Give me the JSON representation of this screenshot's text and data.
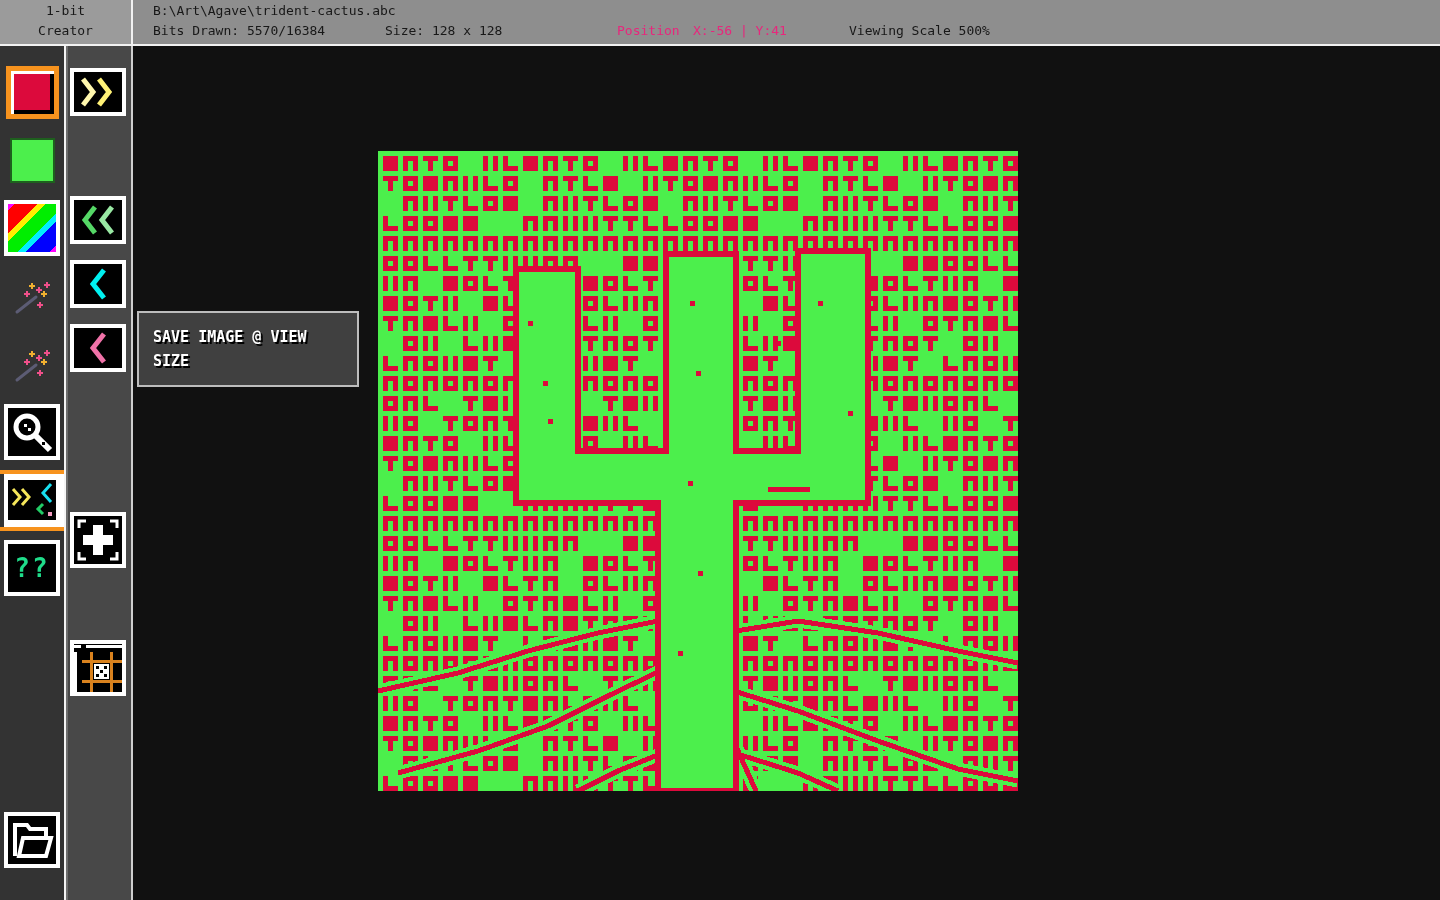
{
  "app_title": [
    "1-bit",
    "Creator"
  ],
  "file_path": "B:\\Art\\Agave\\trident-cactus.abc",
  "status": {
    "bits_drawn": "Bits Drawn: 5570/16384",
    "size": "Size: 128 x 128",
    "position_label": "Position",
    "position_value": "X:-56 | Y:41",
    "viewing_scale": "Viewing Scale 500%"
  },
  "palette": [
    {
      "kind": "solid",
      "color": "#dc0a3c",
      "selected": true
    },
    {
      "kind": "solid",
      "color": "#4cef4c",
      "selected": false
    },
    {
      "kind": "rainbow",
      "selected": false
    }
  ],
  "tools": [
    {
      "kind": "wand",
      "selected": false
    },
    {
      "kind": "wand",
      "selected": false
    },
    {
      "kind": "zoom",
      "selected": false
    },
    {
      "kind": "pattern",
      "selected": true
    },
    {
      "kind": "help",
      "label": "??",
      "selected": false
    },
    {
      "kind": "open",
      "selected": false
    }
  ],
  "secondary_tools": [
    {
      "kind": "double-right",
      "color": "#fff176"
    },
    {
      "kind": "double-left",
      "color": "#55d866"
    },
    {
      "kind": "left",
      "color": "#00f0f0"
    },
    {
      "kind": "left",
      "color": "#f072a8"
    },
    {
      "kind": "plus"
    },
    {
      "kind": "grid"
    }
  ],
  "tooltip": {
    "text": "SAVE IMAGE @ VIEW SIZE"
  }
}
